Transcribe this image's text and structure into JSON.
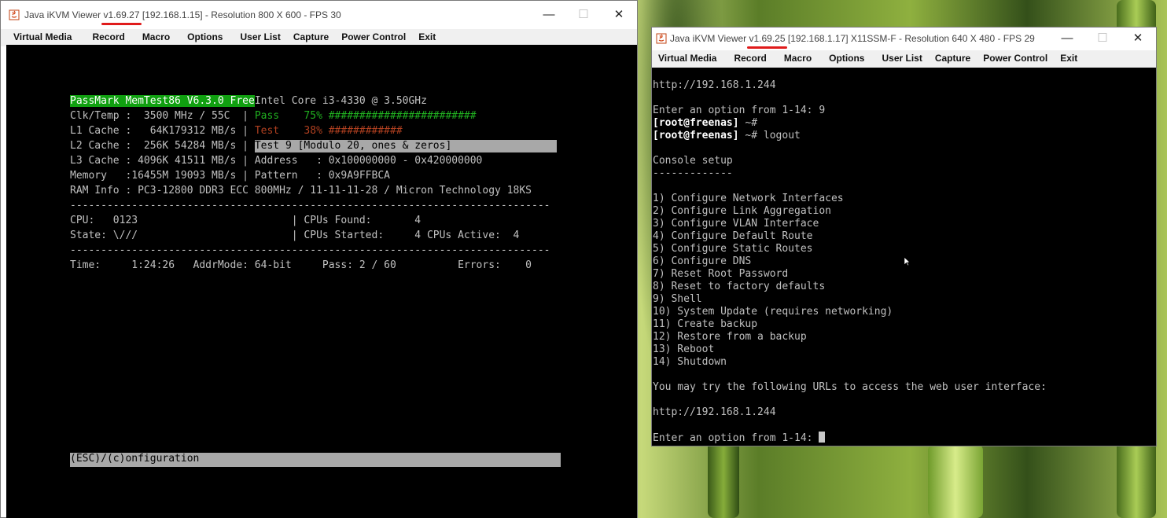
{
  "win1": {
    "title_prefix": "Java iKVM Viewer ",
    "version": "v1.69.27",
    "title_suffix": " [192.168.1.15]  - Resolution 800 X 600 - FPS 30",
    "menu": [
      "Virtual Media",
      "Record",
      "Macro",
      "Options",
      "User List",
      "Capture",
      "Power Control",
      "Exit"
    ],
    "memtest": {
      "banner": "PassMark MemTest86 V6.3.0 Free",
      "cpu": "Intel Core i3-4330 @ 3.50GHz",
      "clk": "Clk/Temp :  3500 MHz / 55C  | ",
      "pass_label": "Pass    75% ",
      "pass_bar": "########################",
      "l1": "L1 Cache :   64K179312 MB/s | ",
      "test_label": "Test    38% ",
      "test_bar": "############",
      "l2": "L2 Cache :  256K 54284 MB/s | ",
      "test_name": "Test 9 [Modulo 20, ones & zeros]",
      "l3": "L3 Cache : 4096K 41511 MB/s | Address   : 0x100000000 - 0x420000000",
      "memory": "Memory   :16455M 19093 MB/s | Pattern   : 0x9A9FFBCA",
      "raminfo": "RAM Info : PC3-12800 DDR3 ECC 800MHz / 11-11-11-28 / Micron Technology 18KS",
      "divider": "------------------------------------------------------------------------------",
      "cpu_line": "CPU:   0123                         | CPUs Found:       4",
      "state_line": "State: \\///                         | CPUs Started:     4 CPUs Active:  4",
      "time_line": "Time:     1:24:26   AddrMode: 64-bit     Pass: 2 / 60          Errors:    0",
      "footer": "(ESC)/(c)onfiguration"
    }
  },
  "win2": {
    "title_prefix": "Java iKVM Viewer ",
    "version": "v1.69.25",
    "title_suffix": " [192.168.1.17] X11SSM-F - Resolution 640 X 480 - FPS 29",
    "menu": [
      "Virtual Media",
      "Record",
      "Macro",
      "Options",
      "User List",
      "Capture",
      "Power Control",
      "Exit"
    ],
    "console": {
      "url_top": "http://192.168.1.244",
      "prompt1": "Enter an option from 1-14: 9",
      "root1_user": "[root@freenas]",
      "root1_rest": " ~#",
      "root2_user": "[root@freenas]",
      "root2_rest": " ~# logout",
      "setup_title": "Console setup",
      "setup_under": "-------------",
      "options": [
        "1) Configure Network Interfaces",
        "2) Configure Link Aggregation",
        "3) Configure VLAN Interface",
        "4) Configure Default Route",
        "5) Configure Static Routes",
        "6) Configure DNS",
        "7) Reset Root Password",
        "8) Reset to factory defaults",
        "9) Shell",
        "10) System Update (requires networking)",
        "11) Create backup",
        "12) Restore from a backup",
        "13) Reboot",
        "14) Shutdown"
      ],
      "urls_msg": "You may try the following URLs to access the web user interface:",
      "url_bottom": "http://192.168.1.244",
      "prompt2": "Enter an option from 1-14: "
    }
  }
}
